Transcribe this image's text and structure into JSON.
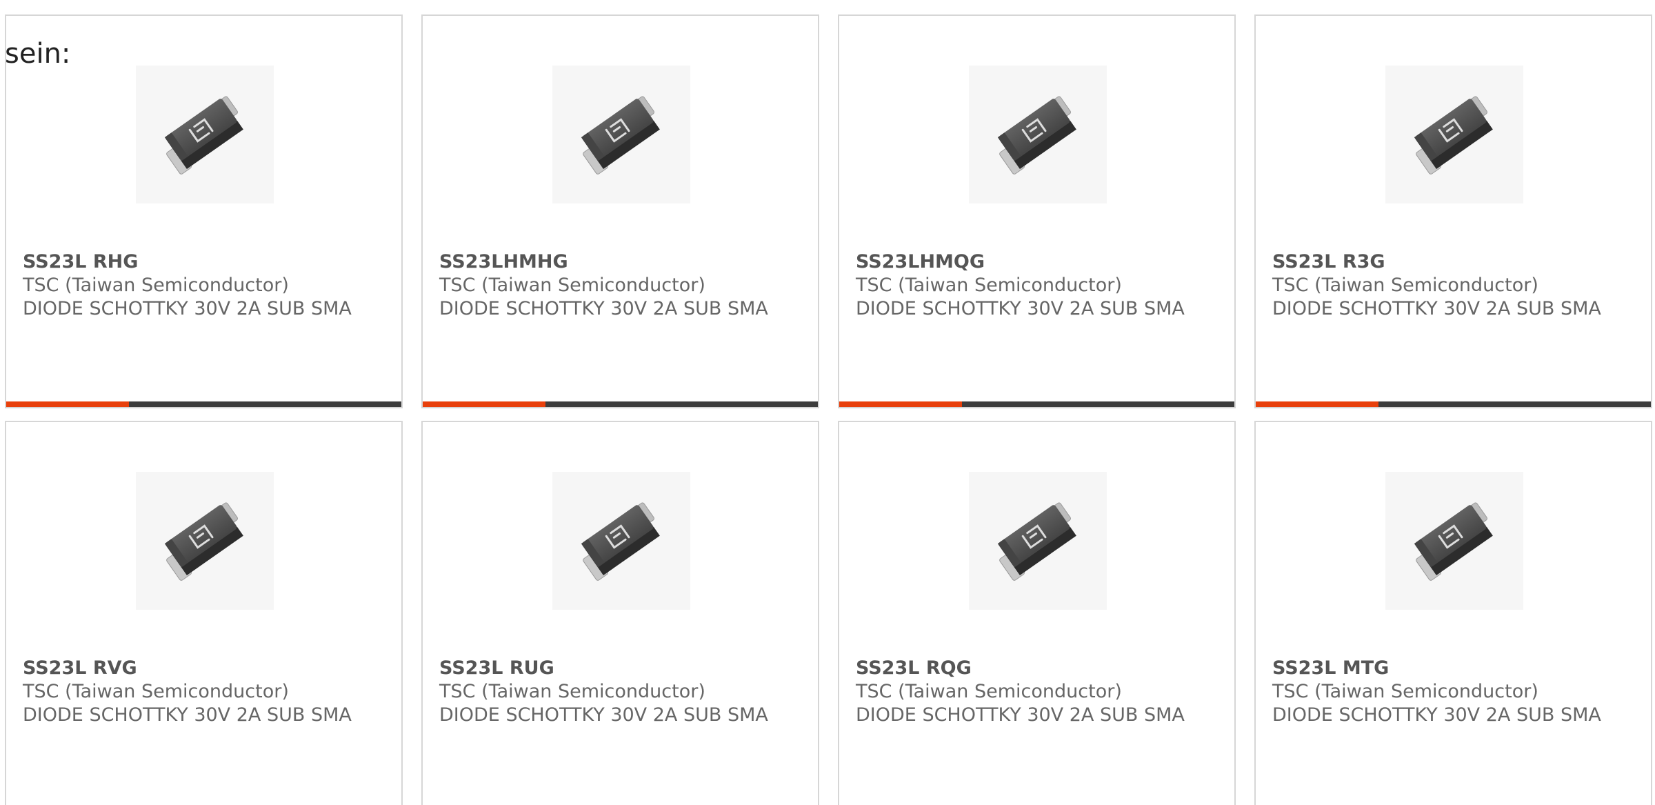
{
  "intro_text": "sein:",
  "colors": {
    "card_border": "#d6d6d6",
    "bar_dark": "#3d3d3d",
    "bar_accent": "#e8400c",
    "text": "#666666"
  },
  "product_icon": "diode-package-icon",
  "products": [
    {
      "part": "SS23L RHG",
      "manufacturer": "TSC (Taiwan Semiconductor)",
      "description": "DIODE SCHOTTKY 30V 2A SUB SMA",
      "progress": 0.31
    },
    {
      "part": "SS23LHMHG",
      "manufacturer": "TSC (Taiwan Semiconductor)",
      "description": "DIODE SCHOTTKY 30V 2A SUB SMA",
      "progress": 0.31
    },
    {
      "part": "SS23LHMQG",
      "manufacturer": "TSC (Taiwan Semiconductor)",
      "description": "DIODE SCHOTTKY 30V 2A SUB SMA",
      "progress": 0.31
    },
    {
      "part": "SS23L R3G",
      "manufacturer": "TSC (Taiwan Semiconductor)",
      "description": "DIODE SCHOTTKY 30V 2A SUB SMA",
      "progress": 0.31
    },
    {
      "part": "SS23L RVG",
      "manufacturer": "TSC (Taiwan Semiconductor)",
      "description": "DIODE SCHOTTKY 30V 2A SUB SMA"
    },
    {
      "part": "SS23L RUG",
      "manufacturer": "TSC (Taiwan Semiconductor)",
      "description": "DIODE SCHOTTKY 30V 2A SUB SMA"
    },
    {
      "part": "SS23L RQG",
      "manufacturer": "TSC (Taiwan Semiconductor)",
      "description": "DIODE SCHOTTKY 30V 2A SUB SMA"
    },
    {
      "part": "SS23L MTG",
      "manufacturer": "TSC (Taiwan Semiconductor)",
      "description": "DIODE SCHOTTKY 30V 2A SUB SMA"
    }
  ]
}
